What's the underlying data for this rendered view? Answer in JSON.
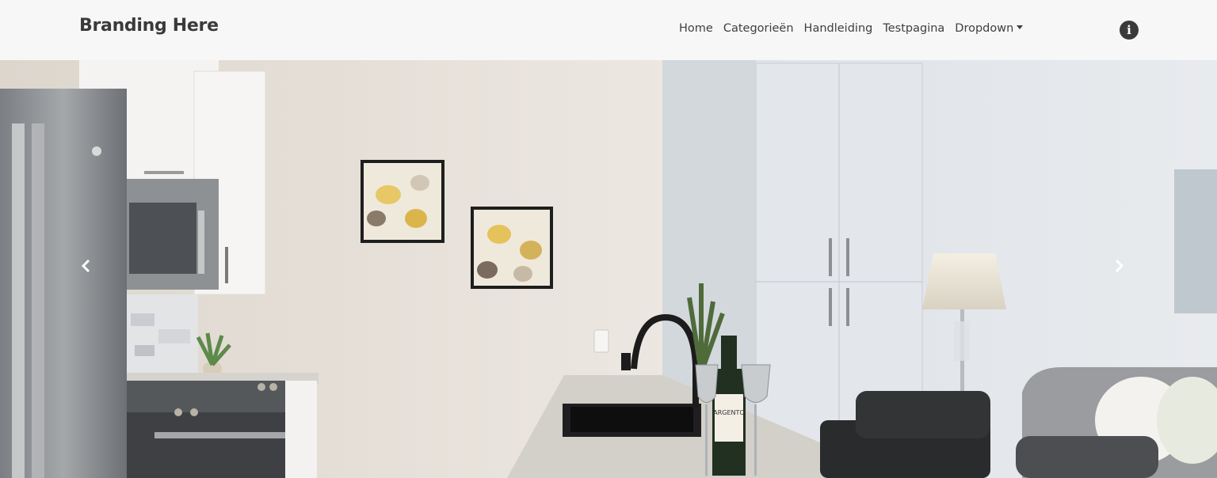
{
  "navbar": {
    "brand": "Branding Here",
    "links": [
      {
        "label": "Home"
      },
      {
        "label": "Categorieën"
      },
      {
        "label": "Handleiding"
      },
      {
        "label": "Testpagina"
      },
      {
        "label": "Dropdown"
      }
    ],
    "info_icon": "info-circle-icon",
    "info_glyph": "i"
  },
  "carousel": {
    "slide_image": "kitchen-living-room-photo",
    "prev_icon": "chevron-left-icon",
    "next_icon": "chevron-right-icon",
    "wine_label": "ARGENTO"
  },
  "colors": {
    "navbar_bg": "#f7f7f7",
    "brand_text": "#3a3a3a",
    "nav_text": "#3f3f3f"
  }
}
